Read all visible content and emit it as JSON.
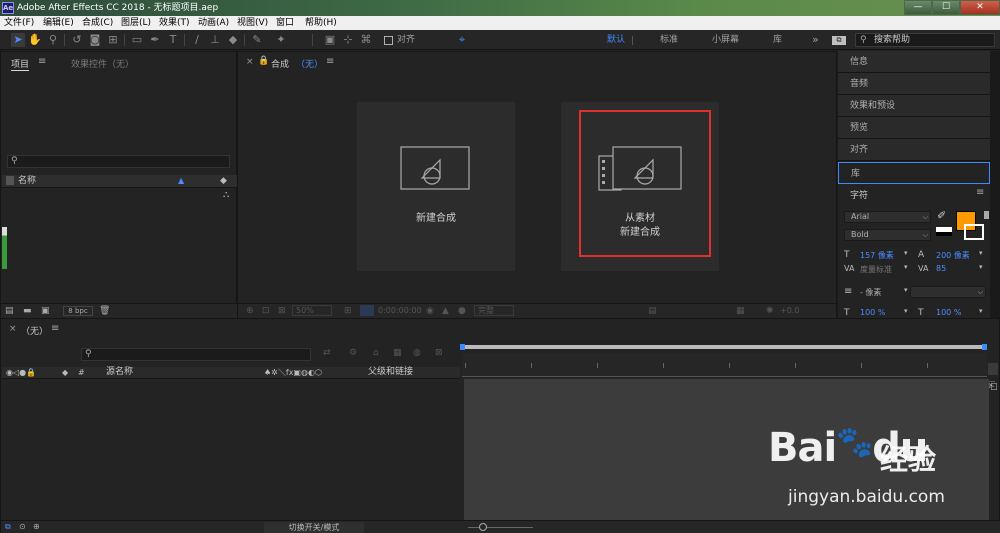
{
  "window": {
    "icon": "Ae",
    "title": "Adobe After Effects CC 2018 - 无标题项目.aep",
    "min": "—",
    "max": "☐",
    "close": "✕"
  },
  "menu": [
    "文件(F)",
    "编辑(E)",
    "合成(C)",
    "图层(L)",
    "效果(T)",
    "动画(A)",
    "视图(V)",
    "窗口",
    "帮助(H)"
  ],
  "toolbar": {
    "snap_label": "对齐",
    "workspaces": [
      "默认",
      "标准",
      "小屏幕",
      "库"
    ],
    "more": "»",
    "search_placeholder": "搜索帮助"
  },
  "project_panel": {
    "tab_project": "项目",
    "tab_effects": "效果控件（无）",
    "col_name": "名称",
    "bpc": "8 bpc"
  },
  "comp_panel": {
    "tab_label": "合成",
    "tab_value": "（无）",
    "new_comp": "新建合成",
    "from_footage_line1": "从素材",
    "from_footage_line2": "新建合成",
    "zoom": "50%",
    "timecode": "0:00:00:00",
    "quality": "完整",
    "exposure": "+0.0"
  },
  "right_panel": {
    "items": [
      "信息",
      "音频",
      "效果和预设",
      "预览",
      "对齐",
      "库"
    ],
    "char_title": "字符",
    "font": "Arial",
    "style": "Bold",
    "font_size": "157 像素",
    "leading": "200 像素",
    "kerning": "度量标准",
    "tracking": "85",
    "indent_label": "- 像素",
    "scale_v": "100 %",
    "scale_h": "100 %",
    "fill_color": "#ff9900"
  },
  "timeline": {
    "tab_label": "（无）",
    "col_source": "源名称",
    "col_parent": "父级和链接",
    "toggle_label": "切换开关/模式"
  },
  "watermark": {
    "logo": "Bai",
    "logo2": "du",
    "cn": "经验",
    "url": "jingyan.baidu.com"
  }
}
